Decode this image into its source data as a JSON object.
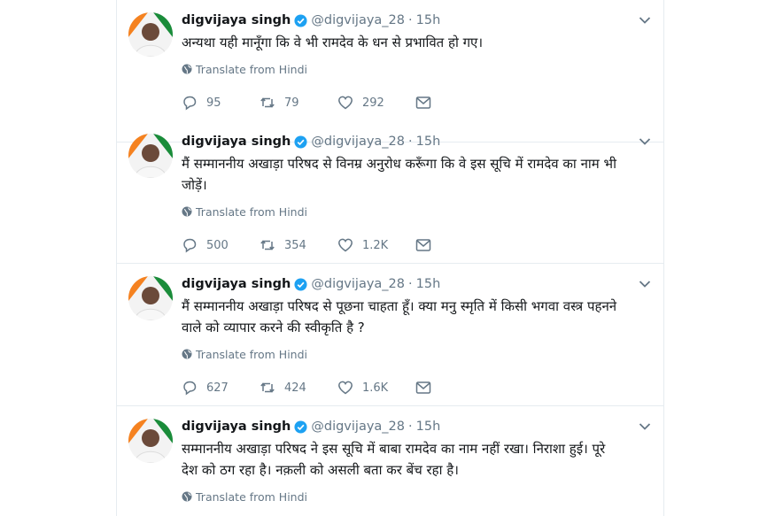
{
  "colors": {
    "accent": "#1da1f2",
    "text": "#14171a",
    "muted": "#657786",
    "divider": "#e6ecf0"
  },
  "tweets": [
    {
      "name": "digvijaya singh",
      "handle": "@digvijaya_28",
      "separator": "·",
      "time": "15h",
      "text": "अन्यथा यही मानूँगा कि वे भी रामदेव के धन से प्रभावित हो गए।",
      "translate": "Translate from Hindi",
      "replies": "95",
      "retweets": "79",
      "likes": "292"
    },
    {
      "name": "digvijaya singh",
      "handle": "@digvijaya_28",
      "separator": "·",
      "time": "15h",
      "text": "मैं सम्माननीय अखाड़ा परिषद से विनम्र अनुरोध करूँगा कि वे इस सूचि में रामदेव का नाम भी जोड़ें।",
      "translate": "Translate from Hindi",
      "replies": "500",
      "retweets": "354",
      "likes": "1.2K"
    },
    {
      "name": "digvijaya singh",
      "handle": "@digvijaya_28",
      "separator": "·",
      "time": "15h",
      "text": "मैं सम्माननीय अखाड़ा परिषद से पूछना चाहता हूँ। क्या मनु स्मृति में किसी भगवा वस्त्र पहनने वाले को  व्यापार करने की स्वीकृति है ?",
      "translate": "Translate from Hindi",
      "replies": "627",
      "retweets": "424",
      "likes": "1.6K"
    },
    {
      "name": "digvijaya singh",
      "handle": "@digvijaya_28",
      "separator": "·",
      "time": "15h",
      "text": "सम्माननीय अखाड़ा परिषद ने इस सूचि में बाबा रामदेव का नाम नहीं रखा। निराशा हुई। पूरे देश को ठग रहा है। नक़ली को असली बता कर बेंच रहा है।",
      "translate": "Translate from Hindi"
    }
  ]
}
